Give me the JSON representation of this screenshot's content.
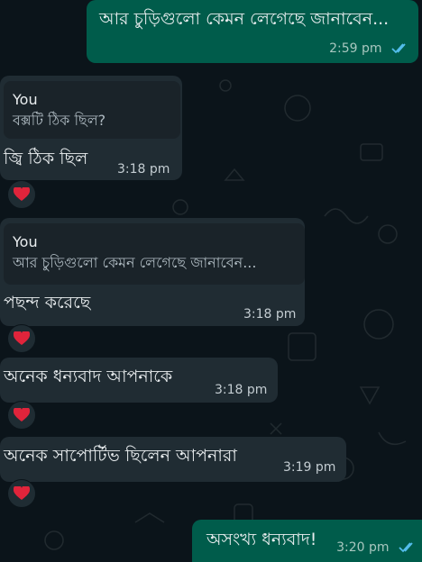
{
  "colors": {
    "background": "#0b141a",
    "incoming_bubble": "#202c33",
    "outgoing_bubble": "#005c4b",
    "read_ticks": "#53bdeb"
  },
  "messages": [
    {
      "id": "m1",
      "direction": "outgoing",
      "text": "আর চুড়িগুলো কেমন লেগেছে জানাবেন...",
      "time": "2:59 pm",
      "status": "read"
    },
    {
      "id": "m2",
      "direction": "incoming",
      "reply_to": {
        "author": "You",
        "text": "বক্সটি ঠিক ছিল?"
      },
      "text": "জ্বি ঠিক ছিল",
      "time": "3:18 pm",
      "reaction": "heart"
    },
    {
      "id": "m3",
      "direction": "incoming",
      "reply_to": {
        "author": "You",
        "text": "আর চুড়িগুলো কেমন লেগেছে জানাবেন..."
      },
      "text": "পছন্দ করেছে",
      "time": "3:18 pm",
      "reaction": "heart"
    },
    {
      "id": "m4",
      "direction": "incoming",
      "text": "অনেক ধন্যবাদ আপনাকে",
      "time": "3:18 pm",
      "reaction": "heart"
    },
    {
      "id": "m5",
      "direction": "incoming",
      "text": "অনেক সাপোর্টিভ ছিলেন আপনারা",
      "time": "3:19 pm",
      "reaction": "heart"
    },
    {
      "id": "m6",
      "direction": "outgoing",
      "text": "অসংখ্য ধন্যবাদ!",
      "time": "3:20 pm",
      "status": "read"
    }
  ]
}
